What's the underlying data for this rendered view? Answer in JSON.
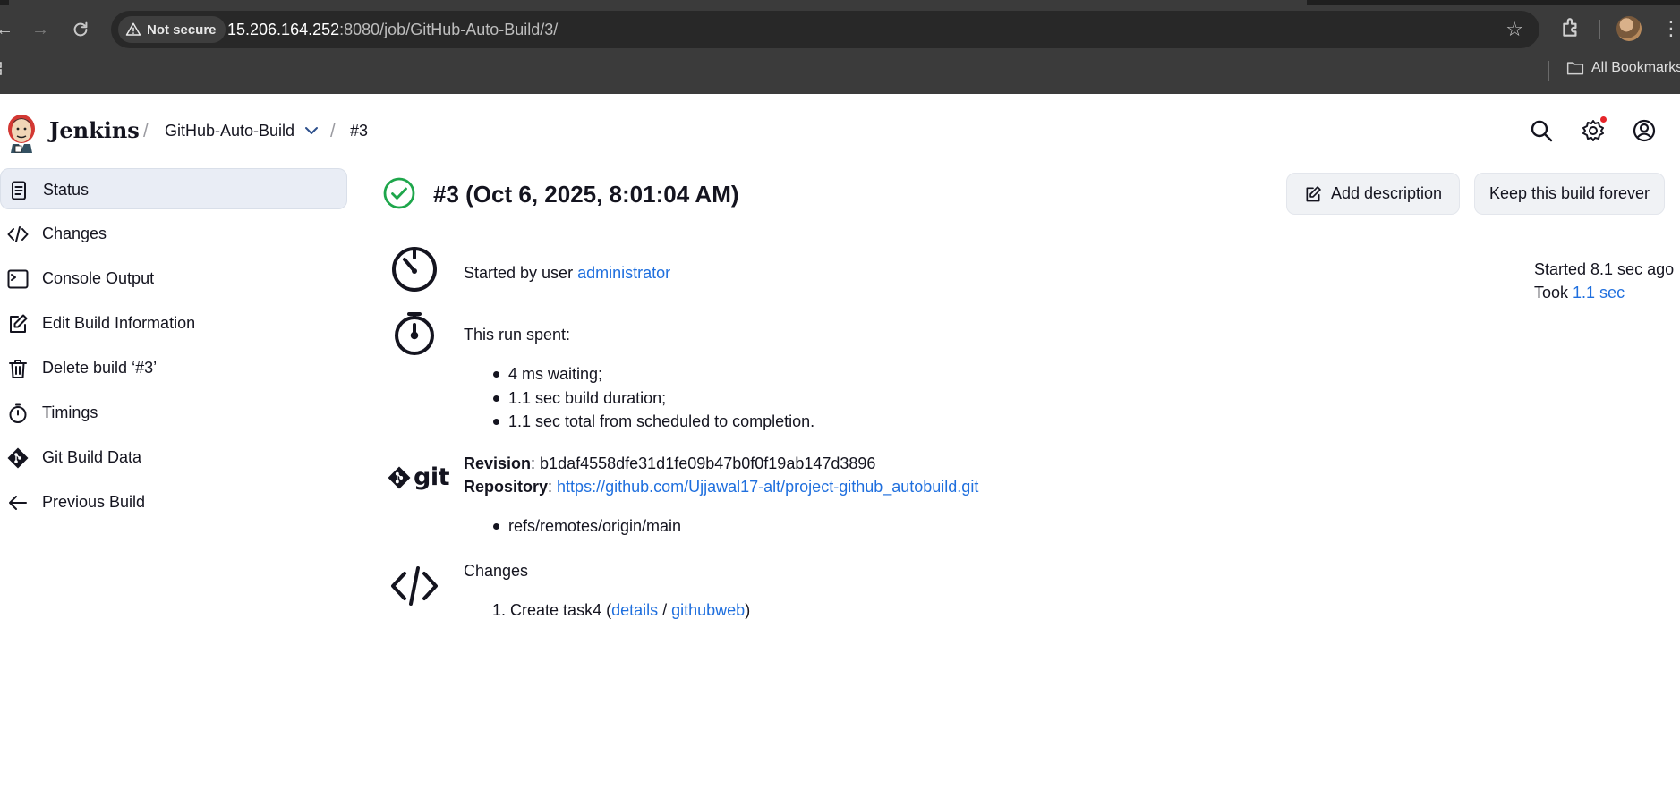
{
  "browser": {
    "security_label": "Not secure",
    "url_host": "15.206.164.252",
    "url_path": ":8080/job/GitHub-Auto-Build/3/",
    "bookmarks_label": "All Bookmarks"
  },
  "header": {
    "brand": "Jenkins",
    "breadcrumb": [
      "GitHub-Auto-Build",
      "#3"
    ],
    "separator": "/"
  },
  "sidebar": {
    "items": [
      {
        "label": "Status",
        "icon": "document-icon",
        "active": true
      },
      {
        "label": "Changes",
        "icon": "code-icon"
      },
      {
        "label": "Console Output",
        "icon": "terminal-icon"
      },
      {
        "label": "Edit Build Information",
        "icon": "edit-icon"
      },
      {
        "label": "Delete build ‘#3’",
        "icon": "trash-icon"
      },
      {
        "label": "Timings",
        "icon": "stopwatch-icon"
      },
      {
        "label": "Git Build Data",
        "icon": "git-icon"
      },
      {
        "label": "Previous Build",
        "icon": "arrow-left-icon"
      }
    ]
  },
  "build": {
    "title": "#3 (Oct 6, 2025, 8:01:04 AM)",
    "status_color": "#1ea64b",
    "add_description": "Add description",
    "keep_forever": "Keep this build forever",
    "started_prefix": "Started by user ",
    "started_user": "administrator",
    "started_ago": "Started 8.1 sec ago",
    "took_prefix": "Took ",
    "took_value": "1.1 sec",
    "run_spent_label": "This run spent:",
    "run_spent": [
      "4 ms waiting;",
      "1.1 sec build duration;",
      "1.1 sec total from scheduled to completion."
    ],
    "git": {
      "logo_text": "git",
      "revision_label": "Revision",
      "revision": "b1daf4558dfe31d1fe09b47b0f0f19ab147d3896",
      "repository_label": "Repository",
      "repository": "https://github.com/Ujjawal17-alt/project-github_autobuild.git",
      "branches": [
        "refs/remotes/origin/main"
      ]
    },
    "changes": {
      "label": "Changes",
      "item_number": "1.",
      "item_text": "Create task4 (",
      "details": "details",
      "slash": " / ",
      "githubweb": "githubweb",
      "close": ")"
    }
  },
  "colors": {
    "link": "#1f6fde",
    "chrome_bg": "#3b3b3b",
    "sidebar_active": "#e9edf5"
  }
}
